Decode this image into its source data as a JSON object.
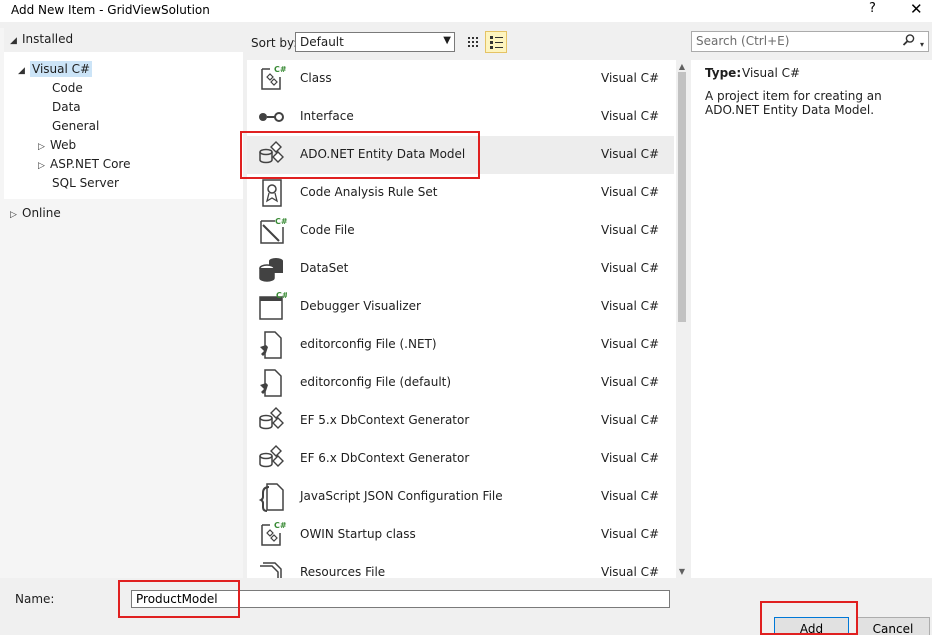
{
  "window": {
    "title": "Add New Item - GridViewSolution",
    "help": "?",
    "close": "✕"
  },
  "tree": {
    "installed": "Installed",
    "items": [
      {
        "label": "Visual C#"
      },
      {
        "label": "Code"
      },
      {
        "label": "Data"
      },
      {
        "label": "General"
      },
      {
        "label": "Web"
      },
      {
        "label": "ASP.NET Core"
      },
      {
        "label": "SQL Server"
      }
    ],
    "online": "Online"
  },
  "toolbar": {
    "sort_label": "Sort by:",
    "sort_value": "Default",
    "search_placeholder": "Search (Ctrl+E)"
  },
  "templates": [
    {
      "name": "Class",
      "lang": "Visual C#",
      "icon": "class-icon"
    },
    {
      "name": "Interface",
      "lang": "Visual C#",
      "icon": "interface-icon"
    },
    {
      "name": "ADO.NET Entity Data Model",
      "lang": "Visual C#",
      "icon": "entity-model-icon"
    },
    {
      "name": "Code Analysis Rule Set",
      "lang": "Visual C#",
      "icon": "rule-set-icon"
    },
    {
      "name": "Code File",
      "lang": "Visual C#",
      "icon": "code-file-icon"
    },
    {
      "name": "DataSet",
      "lang": "Visual C#",
      "icon": "dataset-icon"
    },
    {
      "name": "Debugger Visualizer",
      "lang": "Visual C#",
      "icon": "debugger-visualizer-icon"
    },
    {
      "name": "editorconfig File (.NET)",
      "lang": "Visual C#",
      "icon": "editorconfig-icon"
    },
    {
      "name": "editorconfig File (default)",
      "lang": "Visual C#",
      "icon": "editorconfig-icon"
    },
    {
      "name": "EF 5.x DbContext Generator",
      "lang": "Visual C#",
      "icon": "dbcontext-generator-icon"
    },
    {
      "name": "EF 6.x DbContext Generator",
      "lang": "Visual C#",
      "icon": "dbcontext-generator-icon"
    },
    {
      "name": "JavaScript JSON Configuration File",
      "lang": "Visual C#",
      "icon": "json-config-icon"
    },
    {
      "name": "OWIN Startup class",
      "lang": "Visual C#",
      "icon": "owin-startup-icon"
    },
    {
      "name": "Resources File",
      "lang": "Visual C#",
      "icon": "resources-file-icon"
    }
  ],
  "details": {
    "type_label": "Type:",
    "type_value": "Visual C#",
    "description": "A project item for creating an ADO.NET Entity Data Model."
  },
  "bottom": {
    "name_label": "Name:",
    "name_value": "ProductModel",
    "add_label": "Add",
    "cancel_label": "Cancel"
  },
  "colors": {
    "selection": "#cce4f7",
    "highlight_box": "#e02020",
    "accent": "#0078d7"
  }
}
